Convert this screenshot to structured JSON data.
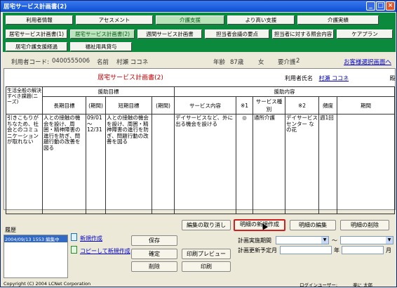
{
  "window": {
    "title": "居宅サービス計画書(2)"
  },
  "nav": {
    "row1": [
      "利用者情報",
      "アセスメント",
      "介護支援",
      "より高い支援",
      "介護実績"
    ],
    "row2": [
      "居宅サービス計画書(1)",
      "居宅サービス計画書(2)",
      "週間サービス計画書",
      "担当者会議の要点",
      "担当者に対する照会内容",
      "ケアプラン"
    ],
    "row3": [
      "居宅介護支援経過",
      "福祉用具貸与"
    ]
  },
  "info": {
    "user_code_label": "利用者コード:",
    "user_code": "0400555006",
    "name_label": "名前",
    "name": "村瀬 ココネ",
    "age_label": "年齢",
    "age": "87歳",
    "sex": "女",
    "care_level_label": "要介護",
    "care_level": "2",
    "select_link": "お客様選択画面へ"
  },
  "doc": {
    "title": "居宅サービス計画書(2)",
    "user_label": "利用者氏名",
    "user_name": "村瀬 ココネ",
    "honorific": "殿"
  },
  "table": {
    "h_needs": "生活全般の解決すべき課題(ニーズ)",
    "h_goals": "援助目標",
    "h_support": "援助内容",
    "h_long": "長期目標",
    "h_period": "(期間)",
    "h_short": "短期目標",
    "h_period2": "(期間)",
    "h_service": "サービス内容",
    "h_mark1": "※1",
    "h_type": "サービス種別",
    "h_mark2": "※2",
    "h_freq": "頻度",
    "h_term": "期間",
    "row": {
      "needs": "引きこもりがちなため、社会とのコミュニケーションが取れない",
      "long": "人との接触の機会を設け、周囲・精神障害の進行を防ぎ、問題行動の改善を図る",
      "period": "09/01～12/31",
      "short": "人との接触の機会を設け、周囲・精神障害の進行を防ぎ、問題行動の改善を図る",
      "period2": "",
      "service": "デイサービスなど、外に出る機会を設ける",
      "mark1": "◎",
      "type": "通所介護",
      "mark2": "デイサービスセンター なの花",
      "freq": "週1回",
      "term": ""
    }
  },
  "history": {
    "label": "履歴",
    "items": [
      "2004/09/13 1553 編集中"
    ]
  },
  "links": {
    "new": "新規作成",
    "copy_new": "コピーして新規作成"
  },
  "buttons": {
    "cancel_edit": "編集の取り消し",
    "new_detail": "明細の新規作成",
    "edit_detail": "明細の編集",
    "delete_detail": "明細の削除",
    "save": "保存",
    "confirm": "確定",
    "print_preview": "印刷プレビュー",
    "delete": "削除",
    "print": "印刷"
  },
  "plan": {
    "period_label": "計画実施期間",
    "range_sep": "～",
    "update_label": "計画更新予定月",
    "year": "年",
    "month": "月"
  },
  "status": {
    "copyright": "Copyright (C) 2004 LCNet Corporation",
    "login_label": "ログインユーザー:",
    "login_user": "楽に 太郎"
  }
}
